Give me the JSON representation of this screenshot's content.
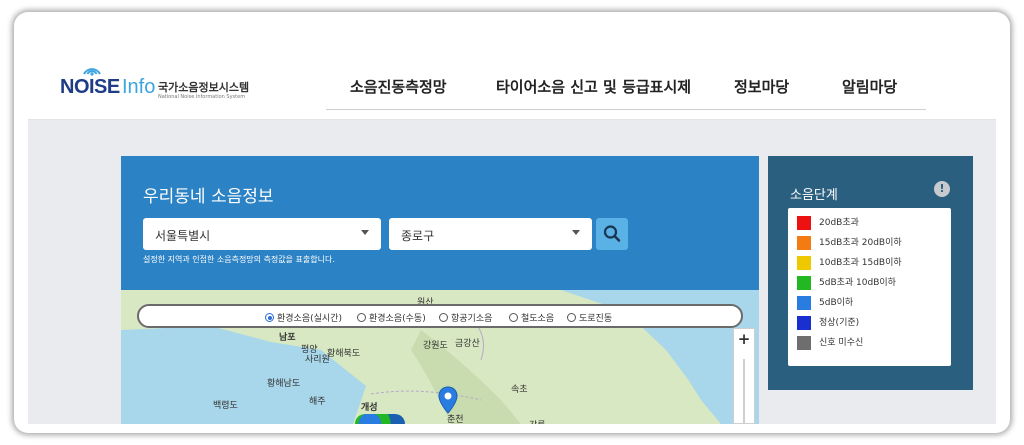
{
  "logo": {
    "brand_a": "NOISE",
    "brand_b": "Info",
    "korean_name": "국가소음정보시스템",
    "english_name": "National Noise Information System"
  },
  "nav": {
    "items": [
      "소음진동측정망",
      "타이어소음 신고 및 등급표시제",
      "정보마당",
      "알림마당"
    ]
  },
  "panel": {
    "title": "우리동네 소음정보",
    "region_select": {
      "value": "서울특별시"
    },
    "district_select": {
      "value": "종로구"
    },
    "note": "설정한 지역과 인접한 소음측정망의 측정값을 표출합니다."
  },
  "map": {
    "radio_options": [
      {
        "label": "환경소음(실시간)",
        "selected": true
      },
      {
        "label": "환경소음(수동)",
        "selected": false
      },
      {
        "label": "항공기소음",
        "selected": false
      },
      {
        "label": "철도소음",
        "selected": false
      },
      {
        "label": "도로진동",
        "selected": false
      }
    ],
    "place_labels": [
      "원산",
      "남포",
      "평양",
      "강원도",
      "금강산",
      "사리원",
      "해주",
      "황해남도",
      "황해북도",
      "개성",
      "춘천",
      "속초",
      "강릉",
      "백령도"
    ],
    "zoom_in": "+"
  },
  "legend": {
    "title": "소음단계",
    "info": "!",
    "items": [
      {
        "label": "20dB초과",
        "color": "#ee1111"
      },
      {
        "label": "15dB초과 20dB이하",
        "color": "#f47a12"
      },
      {
        "label": "10dB초과 15dB이하",
        "color": "#f0c800"
      },
      {
        "label": "5dB초과 10dB이하",
        "color": "#22b822"
      },
      {
        "label": "5dB이하",
        "color": "#2a7de0"
      },
      {
        "label": "정상(기준)",
        "color": "#1a2fd0"
      },
      {
        "label": "신호 미수신",
        "color": "#6e6e6e"
      }
    ]
  },
  "colors": {
    "panel_blue": "#2b82c4",
    "legend_navy": "#2a5f80",
    "brand_navy": "#1f3c87",
    "brand_sky": "#3ca4e0"
  }
}
